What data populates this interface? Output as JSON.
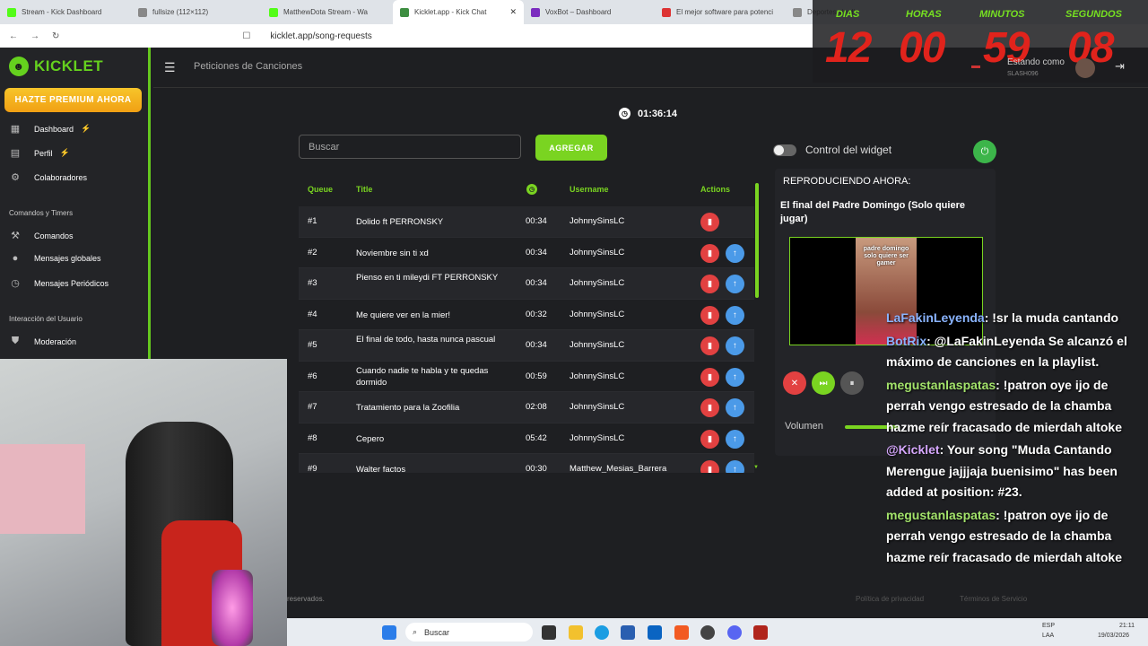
{
  "browser": {
    "tabs": [
      {
        "label": "Stream - Kick Dashboard",
        "color": "#53fc18"
      },
      {
        "label": "fullsize (112×112)",
        "color": "#888888"
      },
      {
        "label": "MatthewDota Stream - Wa",
        "color": "#53fc18"
      },
      {
        "label": "Kicklet.app - Kick Chat",
        "color": "#3e8e41"
      },
      {
        "label": "VoxBot – Dashboard",
        "color": "#7b2cbf"
      },
      {
        "label": "El mejor software para potenci",
        "color": "#d33"
      },
      {
        "label": "Deportes sin di",
        "color": "#888888"
      }
    ],
    "url": "kicklet.app/song-requests"
  },
  "sidebar": {
    "logo": "KICKLET",
    "premium": "HAZTE PREMIUM AHORA",
    "items": [
      {
        "label": "Dashboard",
        "icon": "dashboard-icon",
        "glyph": "▦",
        "bolt": true
      },
      {
        "label": "Perfil",
        "icon": "profile-icon",
        "glyph": "▤",
        "bolt": true
      },
      {
        "label": "Colaboradores",
        "icon": "collaborators-icon",
        "glyph": "⚙",
        "bolt": false
      }
    ],
    "section1": "Comandos y Timers",
    "items2": [
      {
        "label": "Comandos",
        "icon": "hammer-icon",
        "glyph": "⚒"
      },
      {
        "label": "Mensajes globales",
        "icon": "chat-bubble-icon",
        "glyph": "●"
      },
      {
        "label": "Mensajes Periódicos",
        "icon": "clock-icon",
        "glyph": "◷"
      }
    ],
    "section2": "Interacción del Usuario",
    "items3": [
      {
        "label": "Moderación",
        "icon": "shield-icon",
        "glyph": "⛊"
      }
    ]
  },
  "header": {
    "title": "Peticiones de Canciones",
    "timer": "01:36:14"
  },
  "search": {
    "placeholder": "Buscar",
    "add_label": "AGREGAR"
  },
  "table": {
    "headers": {
      "queue": "Queue",
      "title": "Title",
      "username": "Username",
      "actions": "Actions"
    },
    "rows": [
      {
        "q": "#1",
        "t": "Dolido ft PERRONSKY",
        "d": "00:34",
        "u": "JohnnySinsLC",
        "up": false
      },
      {
        "q": "#2",
        "t": "Noviembre sin ti xd",
        "d": "00:34",
        "u": "JohnnySinsLC",
        "up": true
      },
      {
        "q": "#3",
        "t": "Pienso en ti mileydi FT PERRONSKY",
        "d": "00:34",
        "u": "JohnnySinsLC",
        "up": true
      },
      {
        "q": "#4",
        "t": "Me quiere ver en la mier!",
        "d": "00:32",
        "u": "JohnnySinsLC",
        "up": true
      },
      {
        "q": "#5",
        "t": "El final de todo, hasta nunca pascual",
        "d": "00:34",
        "u": "JohnnySinsLC",
        "up": true
      },
      {
        "q": "#6",
        "t": "Cuando nadie te habla y te quedas dormido",
        "d": "00:59",
        "u": "JohnnySinsLC",
        "up": true
      },
      {
        "q": "#7",
        "t": "Tratamiento para la Zoofilia",
        "d": "02:08",
        "u": "JohnnySinsLC",
        "up": true
      },
      {
        "q": "#8",
        "t": "Cepero",
        "d": "05:42",
        "u": "JohnnySinsLC",
        "up": true
      },
      {
        "q": "#9",
        "t": "Walter factos",
        "d": "00:30",
        "u": "Matthew_Mesias_Barrera",
        "up": true
      }
    ]
  },
  "widget": {
    "control_label": "Control del widget",
    "now_playing_label": "REPRODUCIENDO AHORA:",
    "song": "El final del Padre Domingo (Solo quiere jugar)",
    "video_caption": "padre domingo solo quiere ser gamer",
    "volume_label": "Volumen",
    "volume": 0.4
  },
  "stream_overlay": {
    "labels": [
      "DIAS",
      "HORAS",
      "MINUTOS",
      "SEGUNDOS"
    ],
    "values": [
      "12",
      "00",
      "59",
      "08"
    ]
  },
  "user": {
    "status": "Estando como",
    "name": "SLASH096"
  },
  "chat": [
    {
      "name": "LaFakinLeyenda",
      "name_color": "#8ab4ff",
      "text": ": !sr la muda cantando"
    },
    {
      "name": "BotRix",
      "name_color": "#8ab4ff",
      "text": ": @LaFakinLeyenda Se alcanzó el máximo de canciones en la playlist."
    },
    {
      "name": "megustanlaspatas",
      "name_color": "#a3e36b",
      "text": ": !patron oye ijo de perrah vengo estresado de la chamba hazme reír fracasado de mierdah altoke"
    },
    {
      "name": "@Kicklet",
      "name_color": "#d7a8ff",
      "text": ": Your song \"Muda Cantando Merengue jajjjaja buenisimo\" has been added at position: #23."
    },
    {
      "name": "megustanlaspatas",
      "name_color": "#a3e36b",
      "text": ": !patron oye ijo de perrah vengo estresado de la chamba hazme reír fracasado de mierdah altoke"
    }
  ],
  "footer": {
    "left": "reservados.",
    "right1": "Política de privacidad",
    "right2": "Términos de Servicio"
  },
  "taskbar": {
    "search": "Buscar",
    "lang1": "ESP",
    "lang2": "LAA",
    "time": "21:11",
    "date": "19/03/2026"
  }
}
